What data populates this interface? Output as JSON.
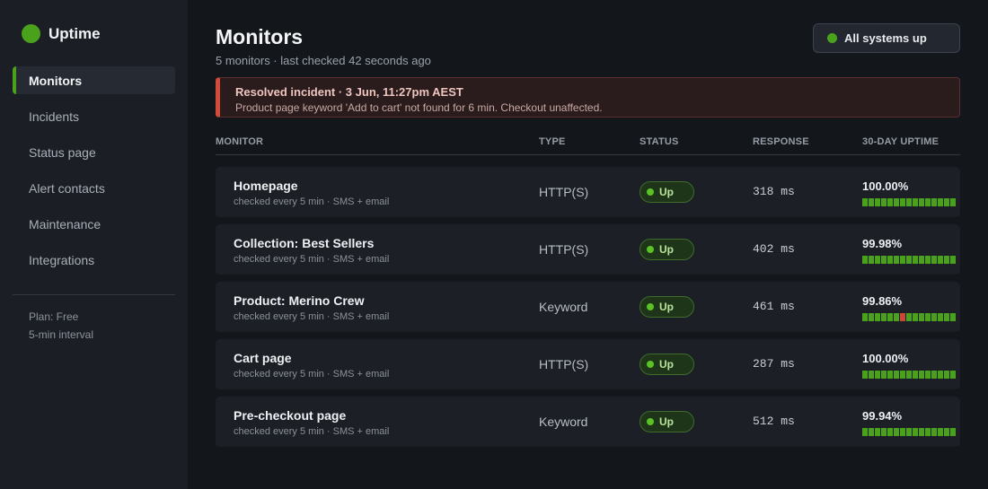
{
  "app": {
    "name": "Uptime",
    "accent": "#4aa21c",
    "danger": "#d24a3a"
  },
  "sidebar": {
    "items": [
      {
        "label": "Monitors",
        "active": true
      },
      {
        "label": "Incidents"
      },
      {
        "label": "Status page"
      },
      {
        "label": "Alert contacts"
      },
      {
        "label": "Maintenance"
      },
      {
        "label": "Integrations"
      }
    ],
    "plan": "Plan: Free",
    "interval": "5-min interval"
  },
  "header": {
    "title": "Monitors",
    "subtitle": "5 monitors  ·  last checked 42 seconds ago",
    "system_status": "All systems up"
  },
  "incident": {
    "title": "Resolved incident  ·  3 Jun, 11:27pm AEST",
    "text": "Product page keyword 'Add to cart' not found for 6 min. Checkout unaffected."
  },
  "table": {
    "headers": [
      "MONITOR",
      "TYPE",
      "STATUS",
      "RESPONSE",
      "30-DAY UPTIME"
    ],
    "rows": [
      {
        "name": "Homepage",
        "sub": "checked every 5 min  ·  SMS + email",
        "type": "HTTP(S)",
        "status": "Up",
        "response": "318 ms",
        "uptime": "100.00%",
        "down_days": []
      },
      {
        "name": "Collection: Best Sellers",
        "sub": "checked every 5 min  ·  SMS + email",
        "type": "HTTP(S)",
        "status": "Up",
        "response": "402 ms",
        "uptime": "99.98%",
        "down_days": []
      },
      {
        "name": "Product: Merino Crew",
        "sub": "checked every 5 min  ·  SMS + email",
        "type": "Keyword",
        "status": "Up",
        "response": "461 ms",
        "uptime": "99.86%",
        "down_days": [
          6
        ]
      },
      {
        "name": "Cart page",
        "sub": "checked every 5 min  ·  SMS + email",
        "type": "HTTP(S)",
        "status": "Up",
        "response": "287 ms",
        "uptime": "100.00%",
        "down_days": []
      },
      {
        "name": "Pre-checkout page",
        "sub": "checked every 5 min  ·  SMS + email",
        "type": "Keyword",
        "status": "Up",
        "response": "512 ms",
        "uptime": "99.94%",
        "down_days": []
      }
    ]
  }
}
